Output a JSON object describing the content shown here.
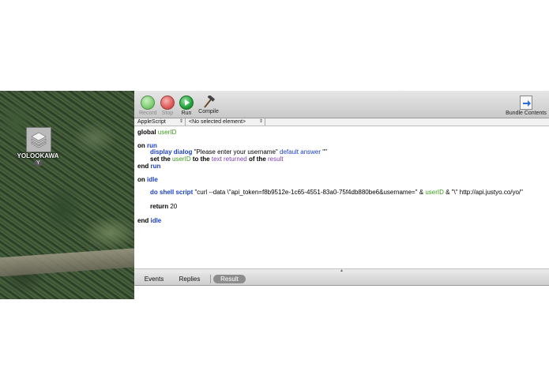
{
  "desktop": {
    "icon_label": "YOLOOKAWA",
    "icon_sublabel": "Y",
    "icon_name": "stack-drive-icon"
  },
  "toolbar": {
    "record_label": "Record",
    "stop_label": "Stop",
    "run_label": "Run",
    "compile_label": "Compile",
    "bundle_label": "Bundle Contents",
    "colors": {
      "record": "#7fcf72",
      "stop": "#e05a5a",
      "run": "#22a23a"
    }
  },
  "navbar": {
    "language": "AppleScript",
    "element": "<No selected element>"
  },
  "script": {
    "l1_kw": "global",
    "l1_var": "userID",
    "l2_kw": "on",
    "l2_ev": "run",
    "l3_cmd": "display dialog",
    "l3_str": "\"Please enter your username\"",
    "l3_param": "default answer",
    "l3_str2": "\"\"",
    "l4_kw": "set the",
    "l4_var": "userID",
    "l4_kw2": "to the",
    "l4_prop": "text returned",
    "l4_kw3": "of the",
    "l4_prop2": "result",
    "l5_kw": "end",
    "l5_ev": "run",
    "l6_kw": "on",
    "l6_ev": "idle",
    "l7_cmd": "do shell script",
    "l7_str": "\"curl --data \\\"api_token=f8b9512e-1c65-4551-83a0-75f4db880be6&username=\"",
    "l7_amp": " & ",
    "l7_var": "userID",
    "l7_amp2": " & ",
    "l7_str2": "\"\\\" http://api.justyo.co/yo/\"",
    "l8_kw": "return",
    "l8_num": "20",
    "l9_kw": "end",
    "l9_ev": "idle"
  },
  "bottom_tabs": {
    "events": "Events",
    "replies": "Replies",
    "result": "Result"
  }
}
